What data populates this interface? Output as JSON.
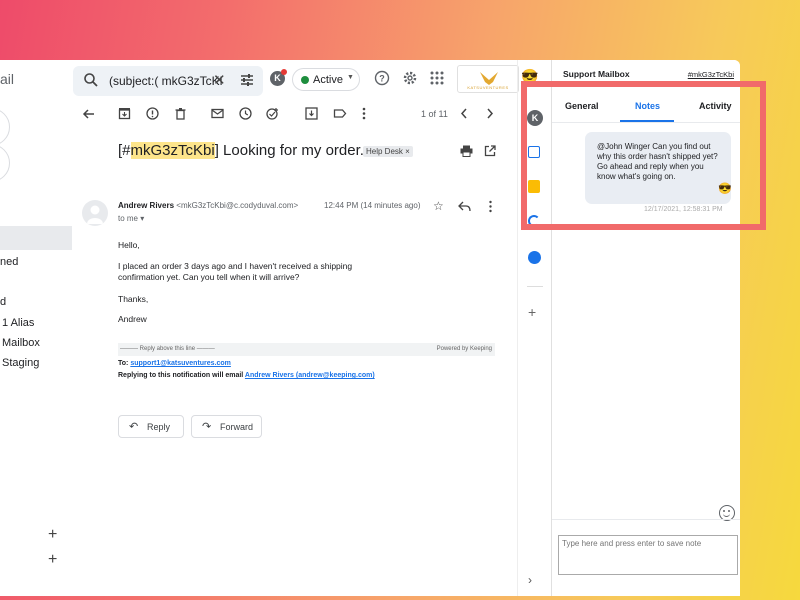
{
  "gmail": {
    "brand_fragment": "ail",
    "nav_items": [
      "ned",
      "d",
      "1 Alias",
      "Mailbox",
      "Staging"
    ],
    "search": {
      "query": "(subject:( mkG3zTcKl"
    },
    "status": {
      "label": "Active",
      "color": "#1e8e3e"
    },
    "logo_text": "KATSUVENTURES",
    "pager": "1 of 11",
    "subject_prefix": "[#",
    "subject_id": "mkG3zTcKbi",
    "subject_rest": "] Looking for my order...",
    "label_chip": "Help Desk ×",
    "sender_name": "Andrew Rivers",
    "sender_email": "<mkG3zTcKbi@c.codyduval.com>",
    "timestamp": "12:44 PM (14 minutes ago)",
    "to_me": "to me ▾",
    "body": {
      "greeting": "Hello,",
      "line1": "I placed an order 3 days ago and I haven't received a shipping",
      "line2": "confirmation yet. Can you tell when it will arrive?",
      "thanks": "Thanks,",
      "name": "Andrew"
    },
    "signature": {
      "reply_above": "——— Reply above this line ———",
      "powered": "Powered by Keeping",
      "to_label": "To:",
      "to_email": "support1@katsuventures.com",
      "reply_note": "Replying to this notification will email",
      "reply_link": "Andrew Rivers (andrew@keeping.com)"
    },
    "buttons": {
      "reply": "Reply",
      "forward": "Forward"
    }
  },
  "panel": {
    "title": "Support Mailbox",
    "ticket_id": "#mkG3zTcKbi",
    "tabs": {
      "general": "General",
      "notes": "Notes",
      "activity": "Activity"
    },
    "note": {
      "text": "@John Winger Can you find out why this order hasn't shipped yet? Go ahead and reply when you know what's going on.",
      "time": "12/17/2021, 12:58:31 PM"
    },
    "input_placeholder": "Type here and press enter to save note"
  },
  "colors": {
    "highlight": "#f16a6a",
    "accent": "#1a73e8"
  }
}
